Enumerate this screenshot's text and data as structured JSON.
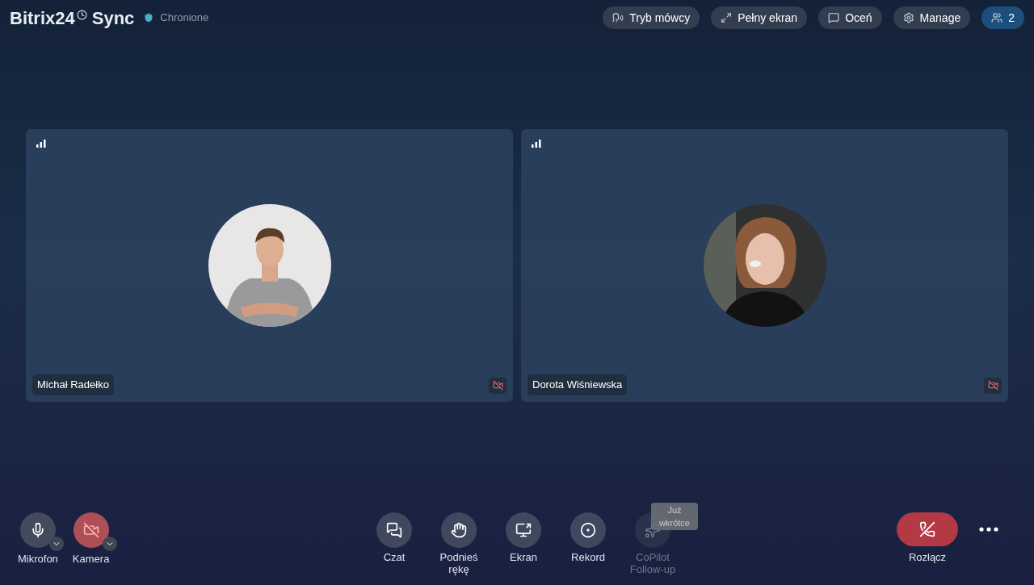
{
  "header": {
    "logo": "Bitrix24",
    "logo_suffix": "Sync",
    "security_status": "Chronione"
  },
  "header_buttons": [
    {
      "kind": "speaker",
      "label": "Tryb mówcy"
    },
    {
      "kind": "fullscreen",
      "label": "Pełny ekran"
    },
    {
      "kind": "rate",
      "label": "Oceń"
    },
    {
      "kind": "settings",
      "label": "Manage"
    },
    {
      "kind": "participants",
      "label": "2"
    }
  ],
  "tiles": [
    {
      "name": "Michał Radełko",
      "camera_off": true
    },
    {
      "name": "Dorota Wiśniewska",
      "camera_off": true
    }
  ],
  "device_controls": [
    {
      "kind": "mic",
      "label": "Mikrofon",
      "muted": false
    },
    {
      "kind": "camera",
      "label": "Kamera",
      "muted": true
    }
  ],
  "actions": [
    {
      "kind": "chat",
      "label": "Czat",
      "disabled": false
    },
    {
      "kind": "hand",
      "label": "Podnieś rękę",
      "disabled": false
    },
    {
      "kind": "screen",
      "label": "Ekran",
      "disabled": false
    },
    {
      "kind": "record",
      "label": "Rekord",
      "disabled": false
    },
    {
      "kind": "copilot",
      "label": "CoPilot Follow-up",
      "disabled": true,
      "tooltip": "Już wkrótce"
    }
  ],
  "hangup": {
    "label": "Rozłącz"
  }
}
